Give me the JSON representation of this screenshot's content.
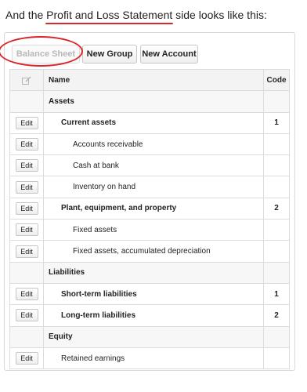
{
  "intro": {
    "before": "And the ",
    "highlight": "Profit and Loss Statement",
    "after": " side looks like this:"
  },
  "toolbar": {
    "balance_sheet": "Balance Sheet",
    "new_group": "New Group",
    "new_account": "New Account"
  },
  "table": {
    "headers": {
      "icon": "edit-icon",
      "name": "Name",
      "code": "Code"
    },
    "edit_label": "Edit",
    "rows": [
      {
        "name": "Assets",
        "code": ""
      },
      {
        "name": "Current assets",
        "code": "1"
      },
      {
        "name": "Accounts receivable",
        "code": ""
      },
      {
        "name": "Cash at bank",
        "code": ""
      },
      {
        "name": "Inventory on hand",
        "code": ""
      },
      {
        "name": "Plant, equipment, and property",
        "code": "2"
      },
      {
        "name": "Fixed assets",
        "code": ""
      },
      {
        "name": "Fixed assets, accumulated depreciation",
        "code": ""
      },
      {
        "name": "Liabilities",
        "code": ""
      },
      {
        "name": "Short-term liabilities",
        "code": "1"
      },
      {
        "name": "Long-term liabilities",
        "code": "2"
      },
      {
        "name": "Equity",
        "code": ""
      },
      {
        "name": "Retained earnings",
        "code": ""
      }
    ]
  },
  "colors": {
    "annotation": "#d9262a",
    "highlight_underline": "#d62a2a"
  }
}
